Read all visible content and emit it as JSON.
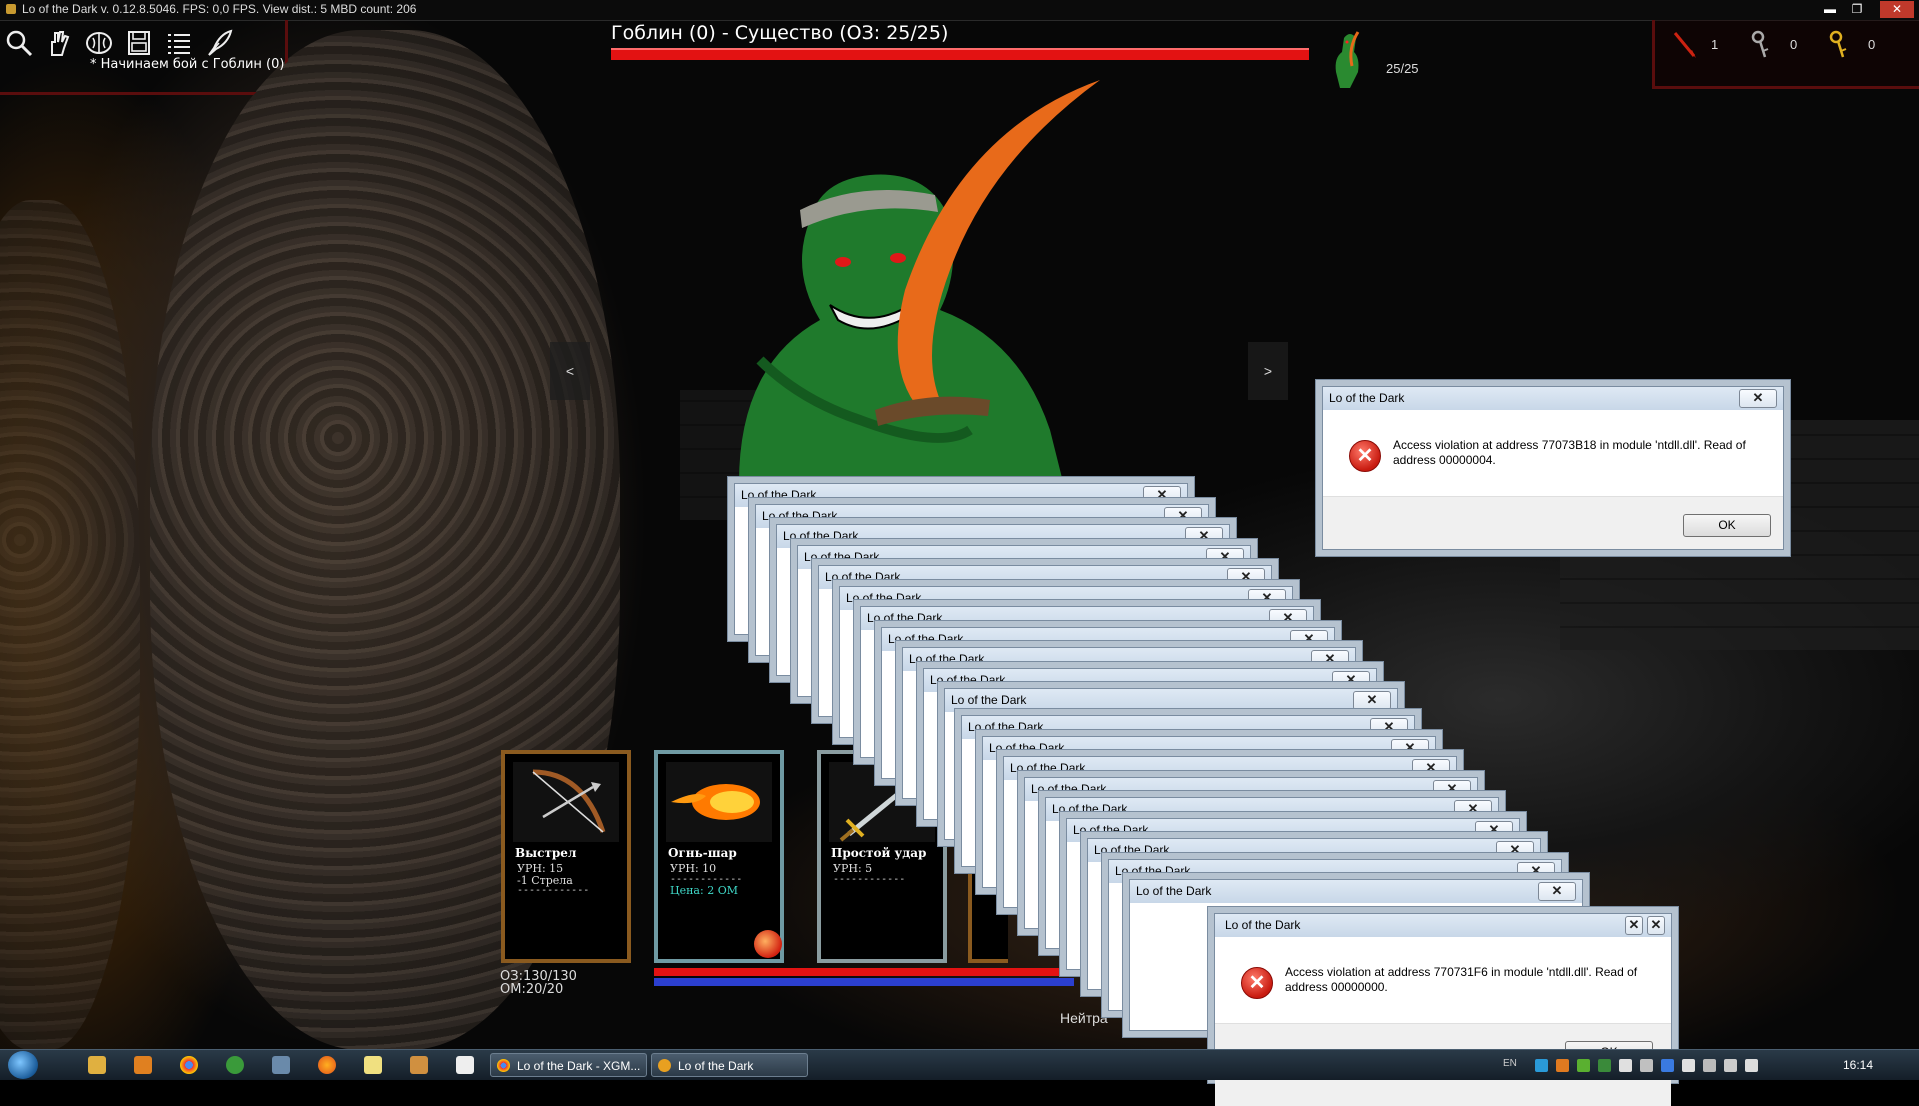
{
  "window": {
    "title": "Lo of the Dark v. 0.12.8.5046. FPS: 0,0 FPS. View dist.: 5 MBD count: 206",
    "minimize": "▬",
    "maximize": "❐",
    "close": "✕"
  },
  "battle_log": "* Начинаем бой с Гоблин (0)",
  "enemy": {
    "title": "Гоблин (0) - Существо (ОЗ: 25/25)",
    "hp_text": "25/25",
    "hp_fraction": 1.0
  },
  "inventory": {
    "arrows": "1",
    "silver_keys": "0",
    "gold_keys": "0"
  },
  "nav": {
    "prev": "<",
    "next": ">"
  },
  "cards": [
    {
      "title": "Выстрел",
      "line1": "УРН: 15",
      "line2": "-1 Стрела",
      "sep": "------------"
    },
    {
      "title": "Огнь-шар",
      "line1": "УРН: 10",
      "sep": "------------",
      "cost": "Цена: 2 ОМ"
    },
    {
      "title": "Простой удар",
      "line1": "УРН: 5",
      "sep": "------------"
    }
  ],
  "player": {
    "hp": "ОЗ:130/130",
    "mp": "ОМ:20/20",
    "hp_fraction": 1.0,
    "mp_fraction": 1.0
  },
  "stance_label": "Нейтра",
  "dialogs": {
    "title": "Lo of the Dark",
    "close": "✕",
    "ok": "OK",
    "top_message": "Access violation at address 77073B18 in module 'ntdll.dll'. Read of address 00000004.",
    "bottom_message": "Access violation at address 770731F6 in module 'ntdll.dll'. Read of address 00000000.",
    "stack_count": 20
  },
  "taskbar": {
    "tasks": [
      {
        "label": "Lo of the Dark - XGM..."
      },
      {
        "label": "Lo of the Dark"
      }
    ],
    "lang": "EN",
    "clock": "16:14"
  },
  "colors": {
    "enemy_hp": "#e31212",
    "player_hp": "#e31212",
    "player_mp": "#2b3fcf",
    "frame_red": "#5a0d0d",
    "goblin_green": "#1f7a2c",
    "blade_orange": "#e86a1a"
  }
}
